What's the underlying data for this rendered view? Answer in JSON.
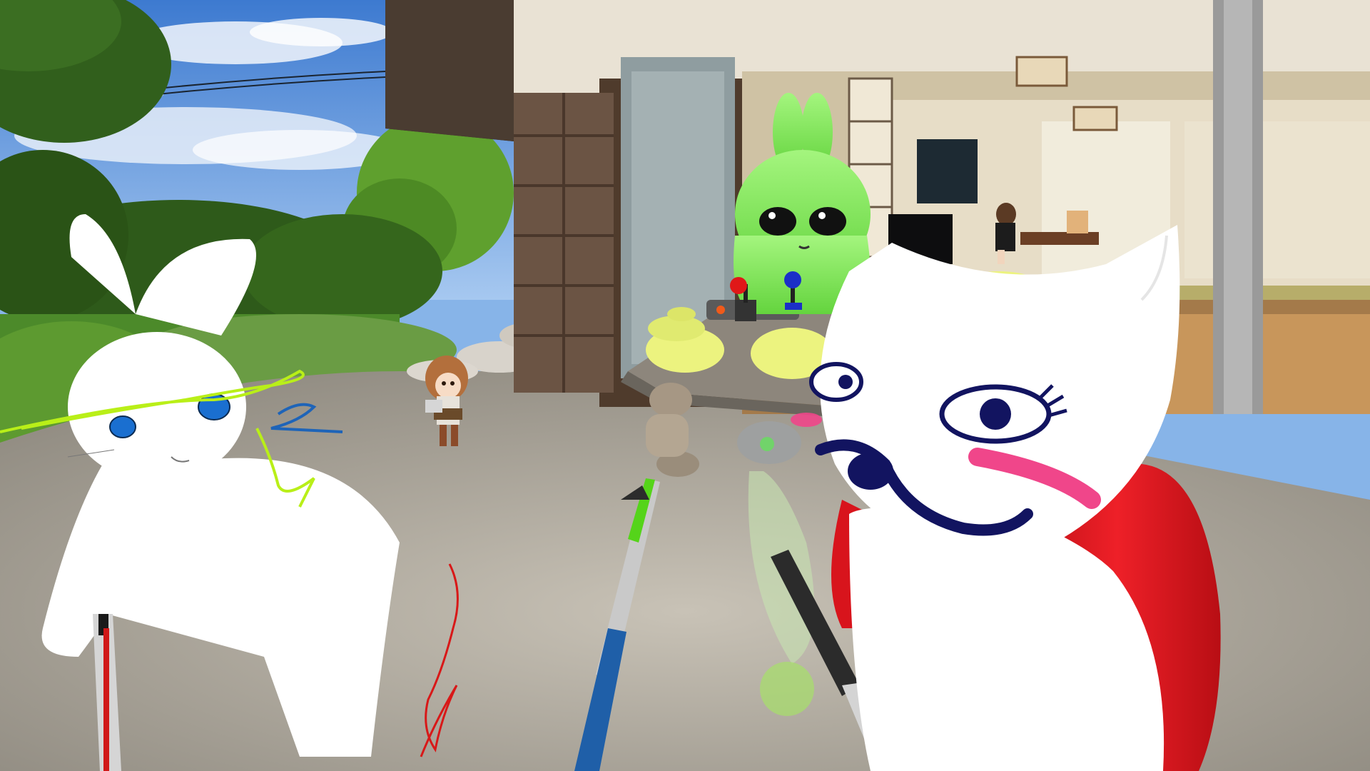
{
  "scene": {
    "type": "vr-game-screenshot",
    "location": "japanese-house-garden",
    "palette": {
      "sky": "#4d86d6",
      "ground": "#b9b2a6",
      "wood": "#5b4636",
      "wall": "#e8e1d3",
      "grass": "#5a8f2e",
      "rabbit_green": "#8ef06a",
      "cheek_pink": "#f0468a",
      "backpack_red": "#e0141e",
      "pen_blue": "#1f5fa8",
      "pen_green": "#53d316",
      "pen_red": "#d01818",
      "pad_yellow": "#e6f07a"
    },
    "icons": [
      "rabbit-avatar-icon",
      "alien-rabbit-avatar-icon",
      "cat-avatar-icon",
      "anime-girl-avatar-icon",
      "pen-icon",
      "joystick-icon"
    ]
  }
}
